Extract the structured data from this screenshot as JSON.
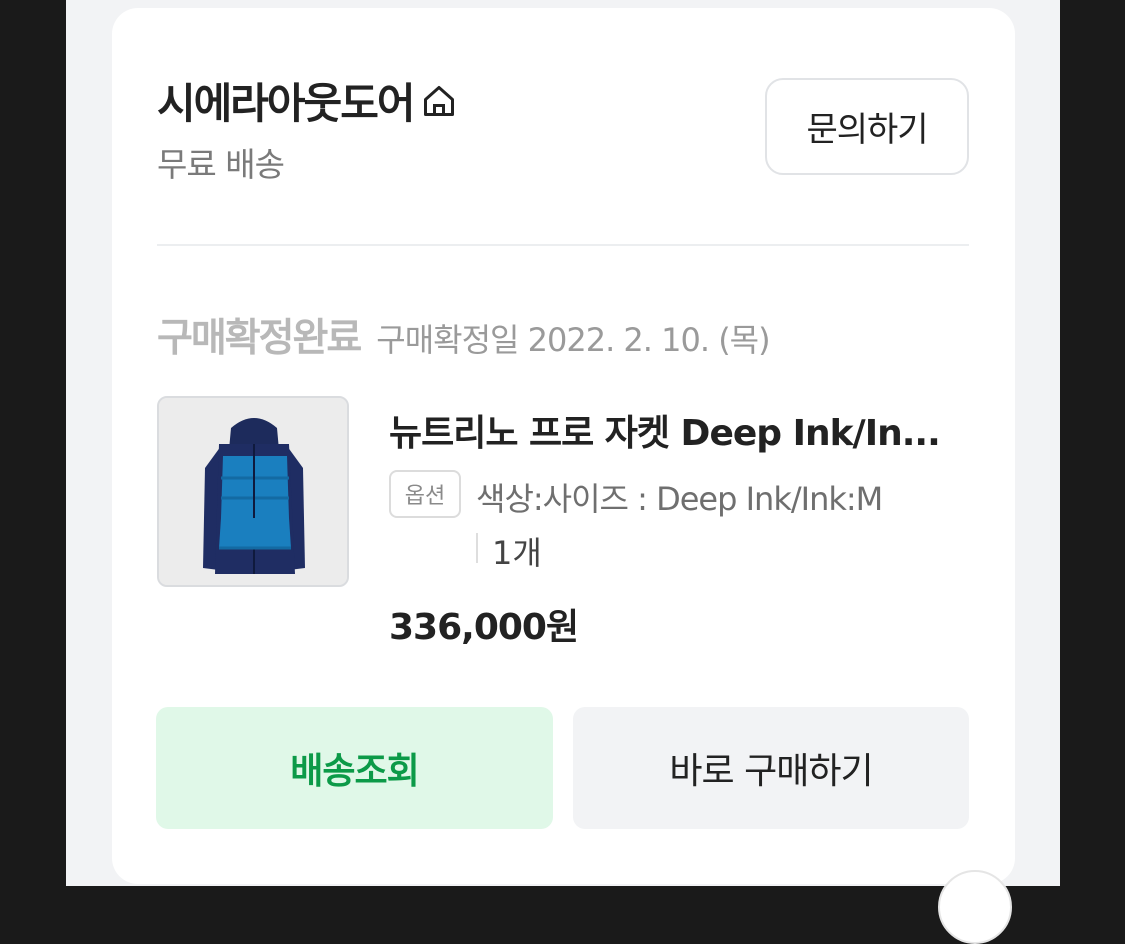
{
  "seller": {
    "name": "시에라아웃도어",
    "shipping": "무료 배송",
    "inquiry_label": "문의하기"
  },
  "order": {
    "status": "구매확정완료",
    "confirm_date": "구매확정일 2022. 2. 10. (목)"
  },
  "product": {
    "name": "뉴트리노 프로 자켓 Deep Ink/In...",
    "option_badge": "옵션",
    "option_text": "색상:사이즈 : Deep Ink/Ink:M",
    "quantity": "1개",
    "price": "336,000원"
  },
  "actions": {
    "track_label": "배송조회",
    "buy_label": "바로 구매하기"
  },
  "colors": {
    "accent_green": "#0c9a48",
    "track_bg": "#e0f8e8"
  }
}
